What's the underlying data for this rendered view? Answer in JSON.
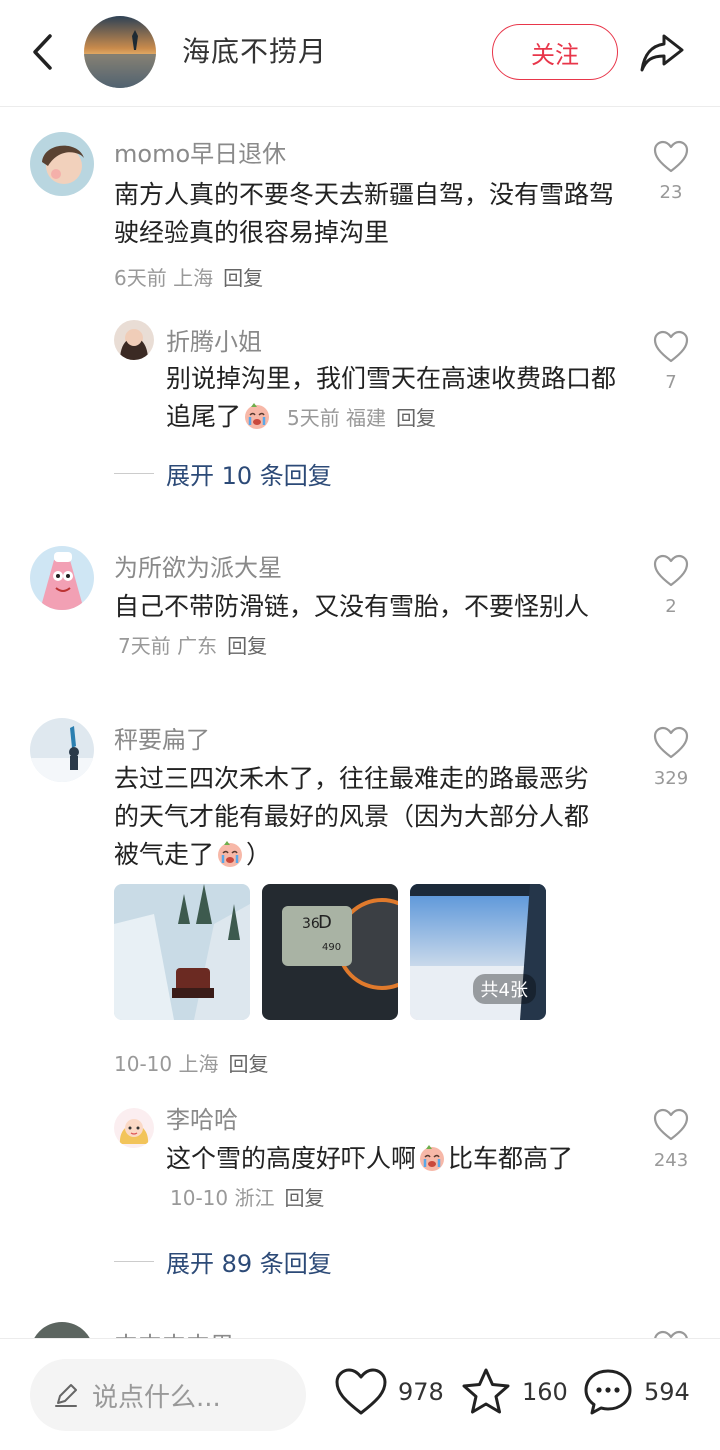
{
  "header": {
    "title": "海底不捞月",
    "follow_label": "关注"
  },
  "comments": [
    {
      "author": "momo早日退休",
      "text": "南方人真的不要冬天去新疆自驾，没有雪路驾驶经验真的很容易掉沟里",
      "meta": "6天前 上海",
      "reply_label": "回复",
      "likes": "23",
      "replies": [
        {
          "author": "折腾小姐",
          "text": "别说掉沟里，我们雪天在高速收费路口都追尾了",
          "meta": "5天前 福建",
          "reply_label": "回复",
          "likes": "7"
        }
      ],
      "expand_label": "展开 10 条回复"
    },
    {
      "author": "为所欲为派大星",
      "text": "自己不带防滑链，又没有雪胎，不要怪别人",
      "meta": "7天前 广东",
      "reply_label": "回复",
      "likes": "2"
    },
    {
      "author": "秤要扁了",
      "text": "去过三四次禾木了，往往最难走的路最恶劣的天气才能有最好的风景（因为大部分人都被气走了",
      "text_end": "）",
      "image_count_label": "共4张",
      "meta": "10-10 上海",
      "reply_label": "回复",
      "likes": "329",
      "replies": [
        {
          "author": "李哈哈",
          "text_a": "这个雪的高度好吓人啊",
          "text_b": "比车都高了",
          "meta": "10-10 浙江",
          "reply_label": "回复",
          "likes": "243"
        }
      ],
      "expand_label": "展开 89 条回复"
    },
    {
      "author": "丰丰丰丰里"
    }
  ],
  "bottom_bar": {
    "input_placeholder": "说点什么...",
    "like_count": "978",
    "star_count": "160",
    "comment_count": "594"
  },
  "colors": {
    "accent": "#e8364a",
    "link": "#2c4a77"
  }
}
